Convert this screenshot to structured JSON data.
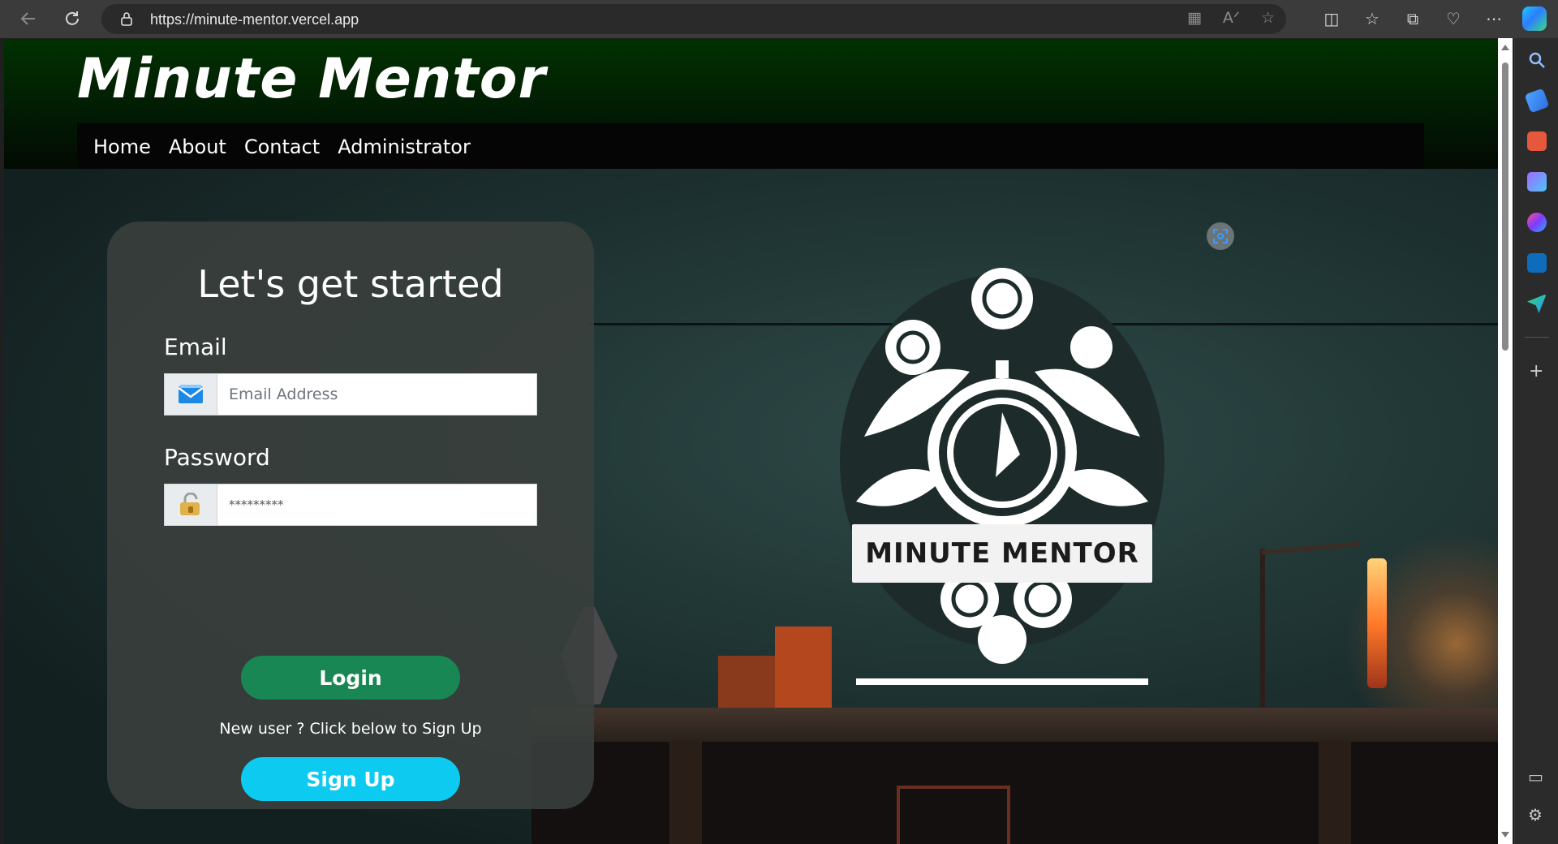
{
  "browser": {
    "url": "https://minute-mentor.vercel.app"
  },
  "site": {
    "brand": "Minute Mentor",
    "nav": [
      {
        "label": "Home"
      },
      {
        "label": "About"
      },
      {
        "label": "Contact"
      },
      {
        "label": "Administrator"
      }
    ]
  },
  "login": {
    "title": "Let's get started",
    "email_label": "Email",
    "email_placeholder": "Email Address",
    "password_label": "Password",
    "password_value": "*********",
    "login_button": "Login",
    "signup_hint": "New user ? Click below to Sign Up",
    "signup_button": "Sign Up"
  },
  "hero": {
    "logo_text": "MINUTE MENTOR"
  },
  "colors": {
    "login_button": "#198754",
    "signup_button": "#0dcaf0",
    "header_green": "#013101"
  }
}
